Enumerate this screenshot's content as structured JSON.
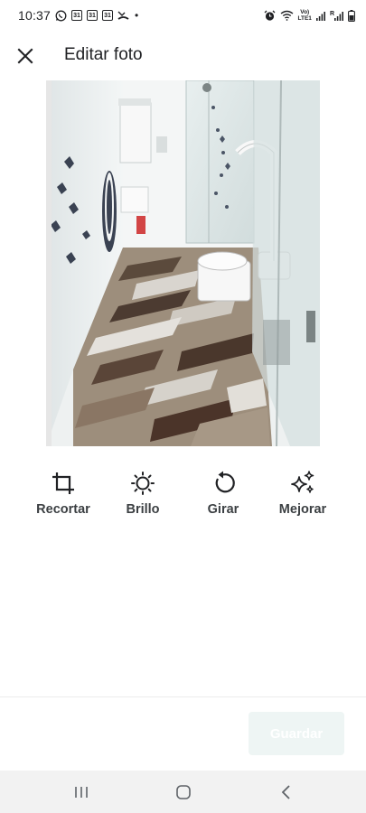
{
  "status_bar": {
    "time": "10:37",
    "calendar_day": "31",
    "dot": "•",
    "network_label_top": "Vo)",
    "network_label_bottom": "LTE1",
    "network_label_right": "R"
  },
  "header": {
    "title": "Editar foto",
    "close_icon": "close-icon"
  },
  "photo": {
    "description_icon": "bathroom-photo"
  },
  "tools": [
    {
      "label": "Recortar",
      "icon": "crop-icon"
    },
    {
      "label": "Brillo",
      "icon": "brightness-icon"
    },
    {
      "label": "Girar",
      "icon": "rotate-icon"
    },
    {
      "label": "Mejorar",
      "icon": "sparkle-icon"
    }
  ],
  "footer": {
    "save_label": "Guardar",
    "save_enabled": false
  },
  "colors": {
    "text": "#202124",
    "tool_label": "#3c4043",
    "save_disabled_bg": "#eef5f4",
    "nav_bg": "#f2f2f2"
  }
}
